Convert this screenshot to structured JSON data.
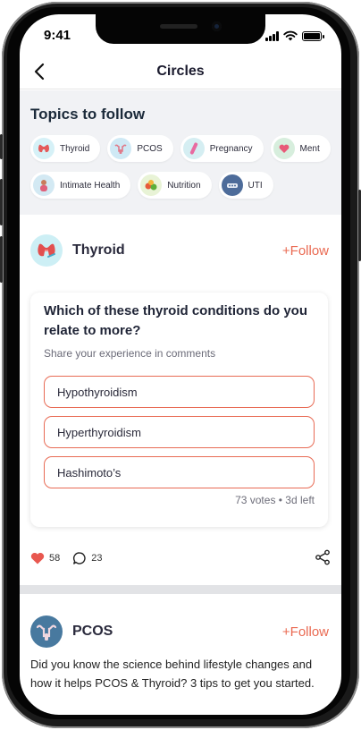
{
  "status_bar": {
    "time": "9:41"
  },
  "nav": {
    "title": "Circles"
  },
  "topics": {
    "title": "Topics to follow",
    "row1": [
      {
        "label": "Thyroid",
        "icon": "thyroid-icon",
        "color": "#d6f1f7"
      },
      {
        "label": "PCOS",
        "icon": "uterus-icon",
        "color": "#cfe9f5"
      },
      {
        "label": "Pregnancy",
        "icon": "pregnancy-test-icon",
        "color": "#d5eef2"
      },
      {
        "label": "Ment",
        "icon": "heart-head-icon",
        "color": "#d7eedd"
      }
    ],
    "row2": [
      {
        "label": "Intimate Health",
        "icon": "intimate-health-icon",
        "color": "#d3e9f3"
      },
      {
        "label": "Nutrition",
        "icon": "nutrition-icon",
        "color": "#e8f3d6"
      },
      {
        "label": "UTI",
        "icon": "uti-icon",
        "color": "#d9e4f1"
      }
    ]
  },
  "post1": {
    "circle": "Thyroid",
    "follow_label": "+Follow",
    "question": "Which of these thyroid conditions do you relate to more?",
    "hint": "Share your experience in comments",
    "options": [
      "Hypothyroidism",
      "Hyperthyroidism",
      "Hashimoto’s"
    ],
    "meta": "73 votes • 3d left",
    "likes": "58",
    "comments": "23"
  },
  "post2": {
    "circle": "PCOS",
    "follow_label": "+Follow",
    "text": "Did you know the science behind lifestyle changes and how it helps PCOS & Thyroid? 3 tips to get you started."
  },
  "colors": {
    "accent": "#ea6a52",
    "like": "#e8574f",
    "section_bg": "#f1f2f5"
  }
}
